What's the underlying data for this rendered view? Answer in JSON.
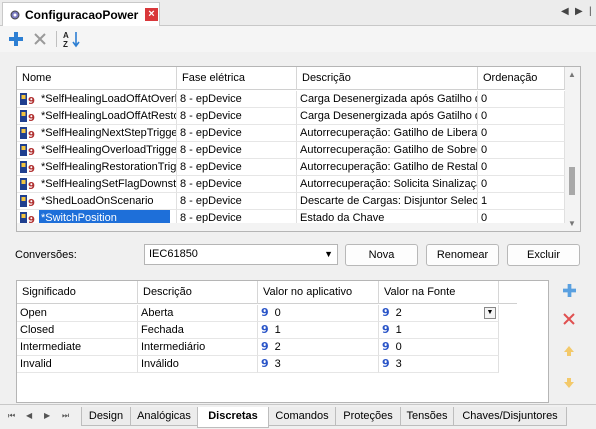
{
  "window": {
    "title": "ConfiguracaoPower",
    "close_glyph": "×",
    "nav_prev": "◀",
    "nav_next": "▶",
    "menu": "|"
  },
  "toolbar": {
    "add_icon": "plus-icon",
    "delete_icon": "x-icon",
    "sort_icon": "sort-az-icon"
  },
  "grid": {
    "columns": [
      "Nome",
      "Fase elétrica",
      "Descrição",
      "Ordenação"
    ],
    "rows": [
      {
        "name": "*SelfHealingLoadOffAtOverl",
        "phase": "8 - epDevice",
        "desc": "Carga Desenergizada após Gatilho de",
        "order": "0"
      },
      {
        "name": "*SelfHealingLoadOffAtResto",
        "phase": "8 - epDevice",
        "desc": "Carga Desenergizada após Gatilho de",
        "order": "0"
      },
      {
        "name": "*SelfHealingNextStepTrigger",
        "phase": "8 - epDevice",
        "desc": "Autorrecuperação: Gatilho de Libera",
        "order": "0"
      },
      {
        "name": "*SelfHealingOverloadTrigger",
        "phase": "8 - epDevice",
        "desc": "Autorrecuperação: Gatilho de Sobrec",
        "order": "0"
      },
      {
        "name": "*SelfHealingRestorationTrigg",
        "phase": "8 - epDevice",
        "desc": "Autorrecuperação: Gatilho de Restab",
        "order": "0"
      },
      {
        "name": "*SelfHealingSetFlagDownstre",
        "phase": "8 - epDevice",
        "desc": "Autorrecuperação: Solicita Sinalizaçã",
        "order": "0"
      },
      {
        "name": "*ShedLoadOnScenario",
        "phase": "8 - epDevice",
        "desc": "Descarte de Cargas: Disjuntor Seleci",
        "order": "1"
      },
      {
        "name": "*SwitchPosition",
        "phase": "8 - epDevice",
        "desc": "Estado da Chave",
        "order": "0"
      }
    ],
    "selected_index": 7
  },
  "conversions": {
    "label": "Conversões:",
    "selected": "IEC61850",
    "buttons": {
      "new": "Nova",
      "rename": "Renomear",
      "delete": "Excluir"
    }
  },
  "states": {
    "columns": [
      "Significado",
      "Descrição",
      "Valor no aplicativo",
      "Valor na Fonte"
    ],
    "rows": [
      {
        "meaning": "Open",
        "desc": "Aberta",
        "app": "0",
        "src": "2"
      },
      {
        "meaning": "Closed",
        "desc": "Fechada",
        "app": "1",
        "src": "1"
      },
      {
        "meaning": "Intermediate",
        "desc": "Intermediário",
        "app": "2",
        "src": "0"
      },
      {
        "meaning": "Invalid",
        "desc": "Inválido",
        "app": "3",
        "src": "3"
      }
    ]
  },
  "tabs": [
    "Design",
    "Analógicas",
    "Discretas",
    "Comandos",
    "Proteções",
    "Tensões",
    "Chaves/Disjuntores"
  ],
  "active_tab": "Discretas",
  "colors": {
    "selection": "#1e6fd9",
    "accent_blue": "#2a55c8",
    "close_red": "#d9373a"
  }
}
